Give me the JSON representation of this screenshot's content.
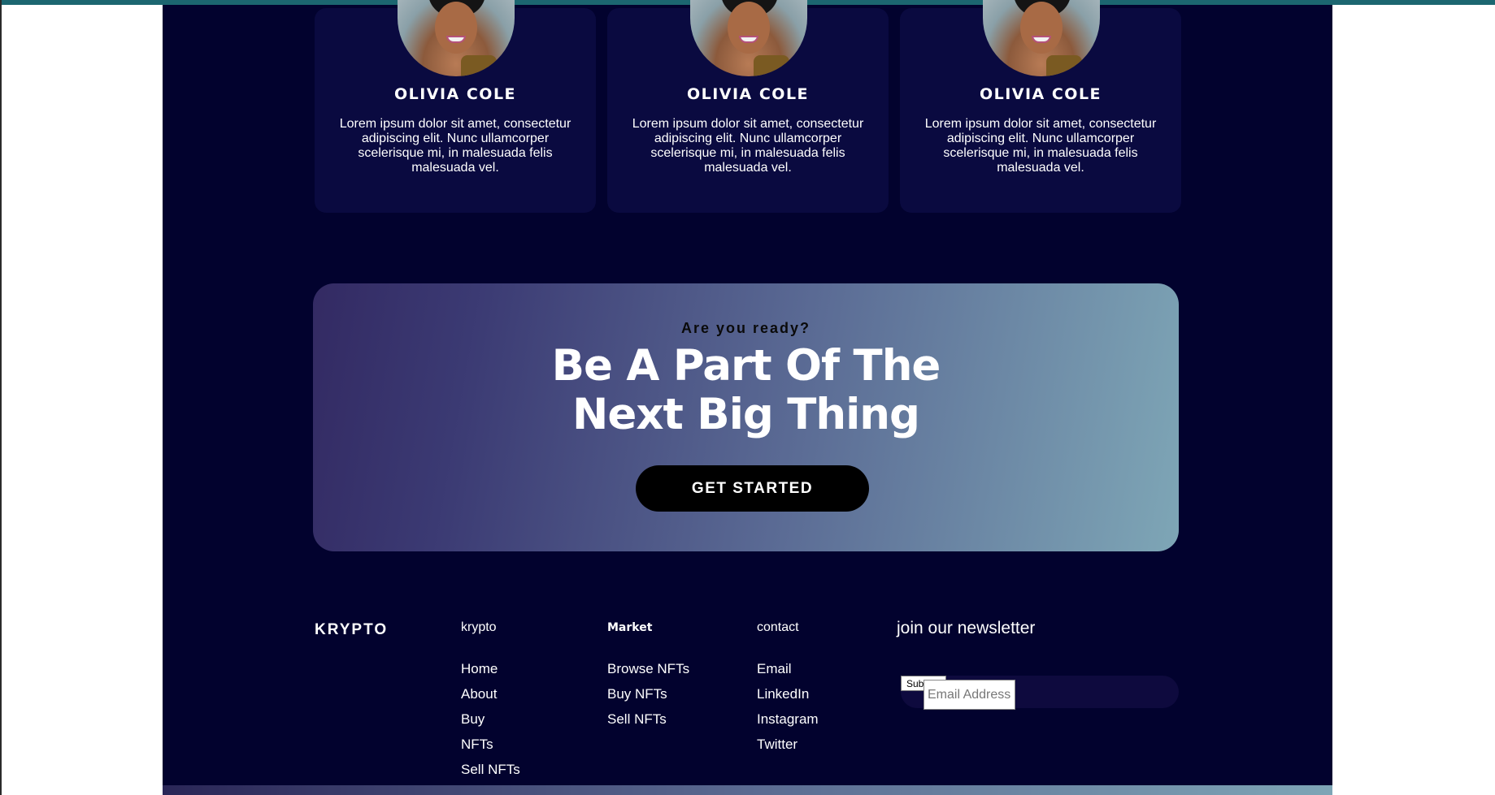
{
  "testimonials": [
    {
      "name": "OLIVIA COLE",
      "text": "Lorem ipsum dolor sit amet, consectetur adipiscing elit. Nunc ullamcorper scelerisque mi, in malesuada felis malesuada vel."
    },
    {
      "name": "OLIVIA COLE",
      "text": "Lorem ipsum dolor sit amet, consectetur adipiscing elit. Nunc ullamcorper scelerisque mi, in malesuada felis malesuada vel."
    },
    {
      "name": "OLIVIA COLE",
      "text": "Lorem ipsum dolor sit amet, consectetur adipiscing elit. Nunc ullamcorper scelerisque mi, in malesuada felis malesuada vel."
    }
  ],
  "cta": {
    "eyebrow": "Are you ready?",
    "title_line1": "Be A Part Of The",
    "title_line2": "Next Big Thing",
    "button_label": "GET STARTED"
  },
  "footer": {
    "brand": "KRYPTO",
    "columns": [
      {
        "heading": "krypto",
        "links": [
          "Home",
          "About",
          "Buy",
          "NFTs",
          "Sell NFTs"
        ]
      },
      {
        "heading": "Market",
        "links": [
          "Browse NFTs",
          "Buy NFTs",
          "Sell NFTs"
        ]
      },
      {
        "heading": "contact",
        "links": [
          "Email",
          "LinkedIn",
          "Instagram",
          "Twitter"
        ]
      }
    ],
    "newsletter": {
      "title": "join our newsletter",
      "submit_label": "Submit",
      "email_placeholder": "Email Address"
    }
  },
  "colors": {
    "page_background": "#02022e",
    "card_background": "#0a0a40",
    "top_accent": "#1c6670",
    "cta_gradient_start": "#332a63",
    "cta_gradient_end": "#7ea6b6",
    "button_background": "#000000"
  }
}
